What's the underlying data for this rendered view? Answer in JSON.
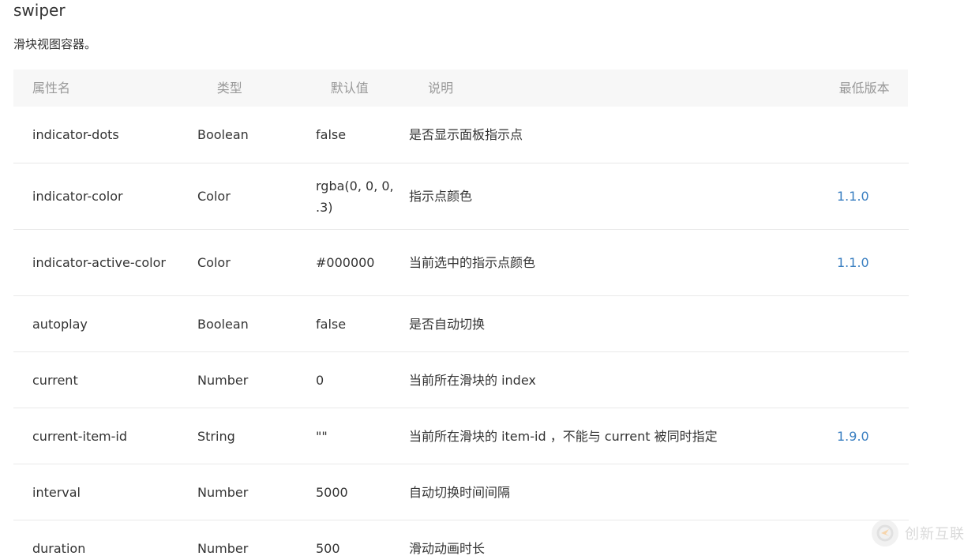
{
  "page": {
    "title": "swiper",
    "description": "滑块视图容器。"
  },
  "table": {
    "headers": {
      "name": "属性名",
      "type": "类型",
      "default": "默认值",
      "description": "说明",
      "version": "最低版本"
    },
    "rows": [
      {
        "name": "indicator-dots",
        "type": "Boolean",
        "default": "false",
        "description": "是否显示面板指示点",
        "version": ""
      },
      {
        "name": "indicator-color",
        "type": "Color",
        "default": "rgba(0, 0, 0, .3)",
        "description": "指示点颜色",
        "version": "1.1.0"
      },
      {
        "name": "indicator-active-color",
        "type": "Color",
        "default": "#000000",
        "description": "当前选中的指示点颜色",
        "version": "1.1.0"
      },
      {
        "name": "autoplay",
        "type": "Boolean",
        "default": "false",
        "description": "是否自动切换",
        "version": ""
      },
      {
        "name": "current",
        "type": "Number",
        "default": "0",
        "description": "当前所在滑块的 index",
        "version": ""
      },
      {
        "name": "current-item-id",
        "type": "String",
        "default": "\"\"",
        "description": "当前所在滑块的 item-id ，不能与 current 被同时指定",
        "version": "1.9.0"
      },
      {
        "name": "interval",
        "type": "Number",
        "default": "5000",
        "description": "自动切换时间间隔",
        "version": ""
      },
      {
        "name": "duration",
        "type": "Number",
        "default": "500",
        "description": "滑动动画时长",
        "version": ""
      }
    ]
  },
  "watermark": {
    "text": "创新互联"
  },
  "colors": {
    "version_link": "#3a7fc1",
    "header_bg": "#f7f7f7",
    "header_text": "#999999"
  }
}
